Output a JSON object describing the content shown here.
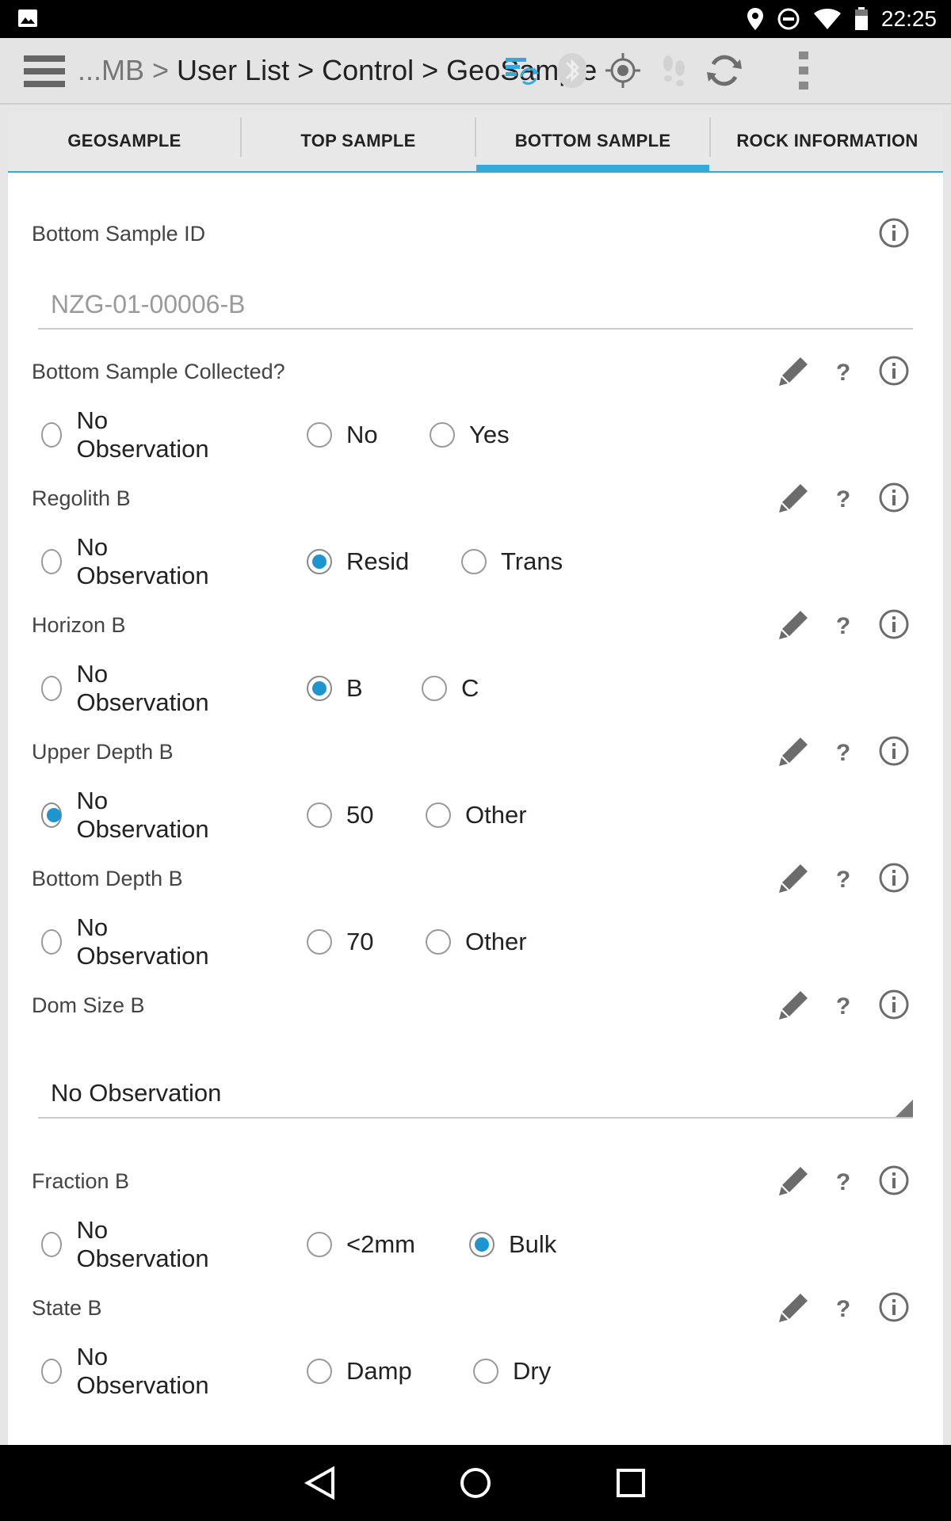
{
  "status_bar": {
    "time": "22:25"
  },
  "toolbar": {
    "breadcrumb_dim": "...MB",
    "breadcrumb_sep": ">",
    "breadcrumb_main": "User List > Control > GeoSample",
    "accent_color": "#34aadc"
  },
  "tabs": [
    {
      "label": "GEOSAMPLE",
      "active": false
    },
    {
      "label": "TOP SAMPLE",
      "active": false
    },
    {
      "label": "BOTTOM SAMPLE",
      "active": true
    },
    {
      "label": "ROCK INFORMATION",
      "active": false
    }
  ],
  "form": {
    "sample_id": {
      "label": "Bottom Sample ID",
      "value": "NZG-01-00006-B"
    },
    "collected": {
      "label": "Bottom Sample Collected?",
      "options": [
        "No Observation",
        "No",
        "Yes"
      ],
      "selected": null
    },
    "regolith": {
      "label": "Regolith B",
      "options": [
        "No Observation",
        "Resid",
        "Trans"
      ],
      "selected": "Resid"
    },
    "horizon": {
      "label": "Horizon B",
      "options": [
        "No Observation",
        "B",
        "C"
      ],
      "selected": "B"
    },
    "upper_depth": {
      "label": "Upper Depth B",
      "options": [
        "No Observation",
        "50",
        "Other"
      ],
      "selected": "No Observation"
    },
    "bottom_depth": {
      "label": "Bottom Depth B",
      "options": [
        "No Observation",
        "70",
        "Other"
      ],
      "selected": null
    },
    "dom_size": {
      "label": "Dom Size B",
      "value": "No Observation"
    },
    "fraction": {
      "label": "Fraction B",
      "options": [
        "No Observation",
        "<2mm",
        "Bulk"
      ],
      "selected": "Bulk"
    },
    "state": {
      "label": "State B",
      "options": [
        "No Observation",
        "Damp",
        "Dry"
      ],
      "selected": null
    }
  },
  "icons": {
    "edit": "pencil-icon",
    "help": "question-icon",
    "info": "info-icon",
    "selected_radio_color": "#1f95cf"
  }
}
